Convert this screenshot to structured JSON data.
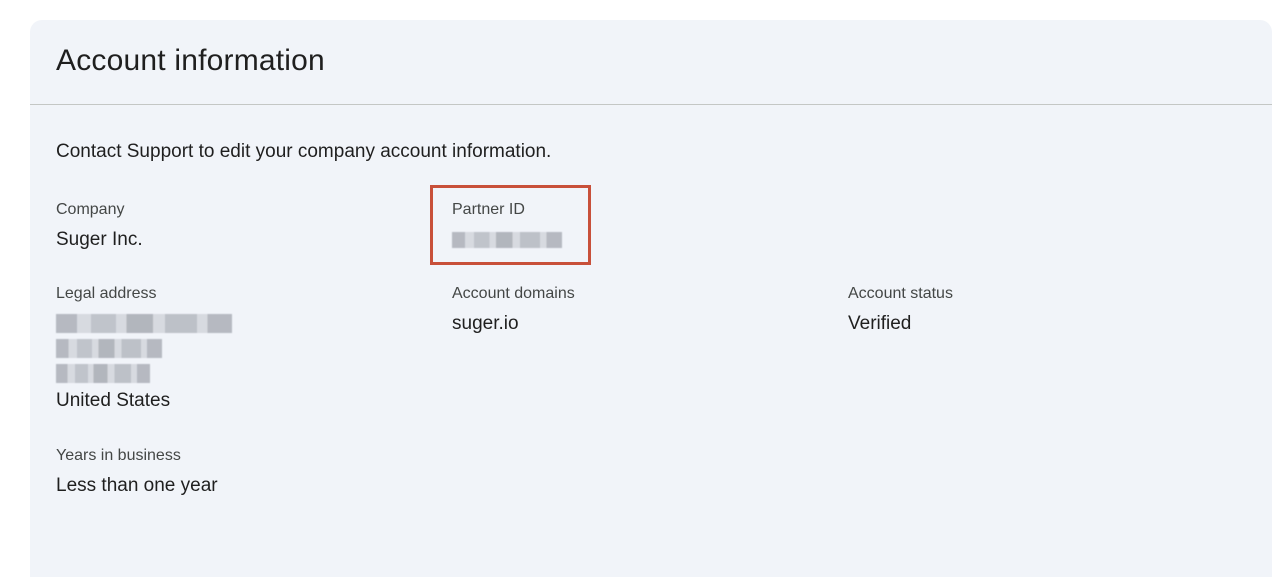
{
  "card": {
    "title": "Account information",
    "intro": "Contact Support to edit your company account information."
  },
  "fields": {
    "company": {
      "label": "Company",
      "value": "Suger Inc."
    },
    "partner_id": {
      "label": "Partner ID"
    },
    "legal_address": {
      "label": "Legal address",
      "country": "United States"
    },
    "account_domains": {
      "label": "Account domains",
      "value": "suger.io"
    },
    "account_status": {
      "label": "Account status",
      "value": "Verified"
    },
    "years_in_business": {
      "label": "Years in business",
      "value": "Less than one year"
    }
  },
  "colors": {
    "card_background": "#f1f4f9",
    "highlight_border": "#c8503a",
    "label_text": "#444746",
    "value_text": "#1f1f1f"
  }
}
